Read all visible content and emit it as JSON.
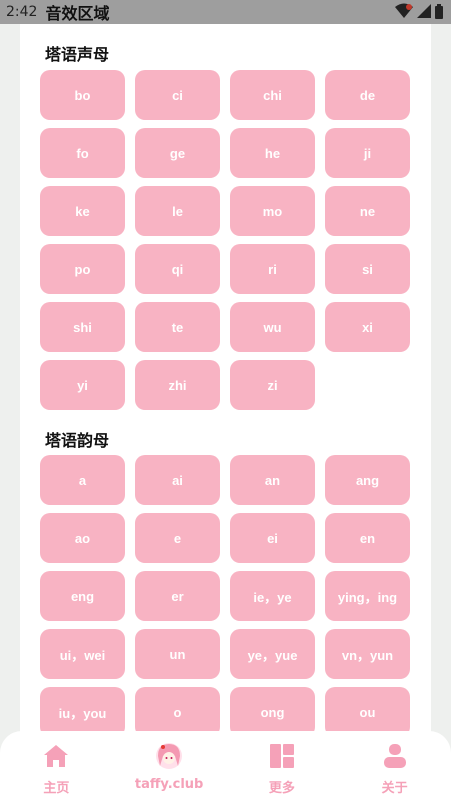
{
  "status": {
    "time": "2:42",
    "title": "音效区域"
  },
  "sections": [
    {
      "title": "塔语声母",
      "items": [
        "bo",
        "ci",
        "chi",
        "de",
        "fo",
        "ge",
        "he",
        "ji",
        "ke",
        "le",
        "mo",
        "ne",
        "po",
        "qi",
        "ri",
        "si",
        "shi",
        "te",
        "wu",
        "xi",
        "yi",
        "zhi",
        "zi"
      ]
    },
    {
      "title": "塔语韵母",
      "items": [
        "a",
        "ai",
        "an",
        "ang",
        "ao",
        "e",
        "ei",
        "en",
        "eng",
        "er",
        "ie，ye",
        "ying，ing",
        "ui，wei",
        "un",
        "ye，yue",
        "vn，yun",
        "iu，you",
        "o",
        "ong",
        "ou"
      ]
    }
  ],
  "nav": [
    {
      "label": "主页",
      "icon": "home-icon"
    },
    {
      "label": "taffy.club",
      "icon": "avatar-icon"
    },
    {
      "label": "更多",
      "icon": "dashboard-icon"
    },
    {
      "label": "关于",
      "icon": "user-icon"
    }
  ],
  "colors": {
    "pill": "#f8b3c3",
    "accent": "#f5a1b8",
    "status_bar": "#9e9e9e"
  }
}
